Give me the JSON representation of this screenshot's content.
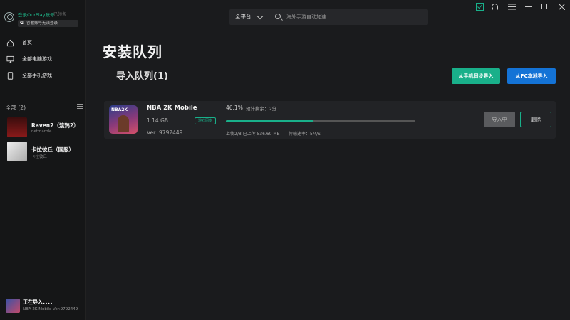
{
  "sidebar": {
    "login_link": "登录OurPlay账号",
    "login_status": "已领条",
    "google_chip": "谷歌账号无法登录",
    "nav": [
      {
        "label": "首页",
        "icon": "home-icon"
      },
      {
        "label": "全部电脑游戏",
        "icon": "monitor-icon"
      },
      {
        "label": "全部手机游戏",
        "icon": "phone-icon"
      }
    ],
    "section_title": "全部 (2)",
    "games": [
      {
        "title": "Raven2（渡鸦2）",
        "sub": "netmarble"
      },
      {
        "title": "卡拉彼丘（国服）",
        "sub": "卡拉彼丘"
      }
    ],
    "footer": {
      "title": "正在导入．．．．",
      "sub": "NBA 2K Mobile Ver:9792449"
    }
  },
  "topbar": {
    "platform": "全平台",
    "search_placeholder": "海外手游自动加速"
  },
  "main": {
    "page_title": "安装队列",
    "queue_title": "导入队列(1)",
    "btn_phone_sync": "从手机同步导入",
    "btn_pc_local": "从PC本地导入"
  },
  "queue": [
    {
      "name": "NBA 2K Mobile",
      "size": "1.14 GB",
      "version": "Ver: 9792449",
      "tag": "游戏同步",
      "percent": "46.1%",
      "progress": 0.461,
      "remaining": "预计剩余：2分",
      "transfer": "上传2/8 已上传 536.60 MB",
      "rate": "传输速率：5M/S",
      "btn_importing": "导入中",
      "btn_delete": "删除",
      "thumb_logo": "NBA2K"
    }
  ],
  "colors": {
    "accent_green": "#19b08a",
    "accent_blue": "#1473d6"
  }
}
